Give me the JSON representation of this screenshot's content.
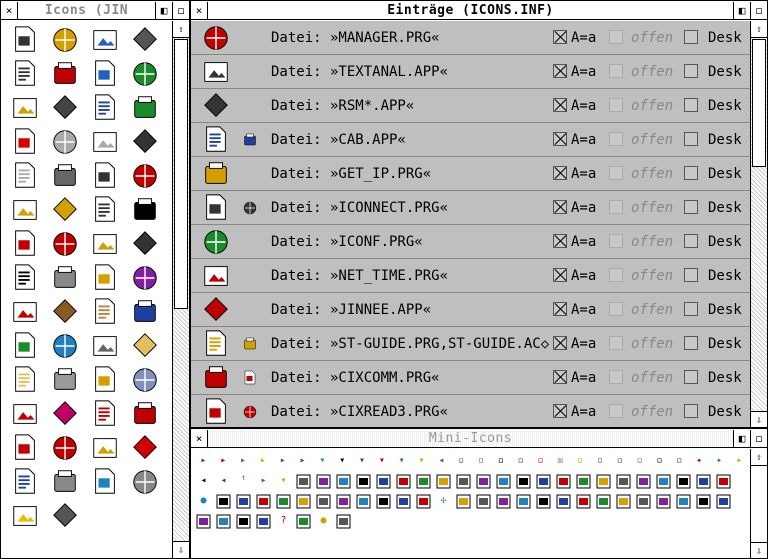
{
  "icons_window": {
    "title": "Icons (JIN",
    "close_glyph": "×",
    "icons": [
      {
        "name": "calculator-numbers-icon",
        "color": "#333"
      },
      {
        "name": "pencil-paper-icon",
        "color": "#d4a000"
      },
      {
        "name": "paint-document-icon",
        "color": "#2060c0"
      },
      {
        "name": "sound-device-icon",
        "color": "#555"
      },
      {
        "name": "grid-document-icon",
        "color": "#333"
      },
      {
        "name": "gif-document-icon",
        "color": "#c00000"
      },
      {
        "name": "jpeg-document-icon",
        "color": "#2060c0"
      },
      {
        "name": "globe-pencil-icon",
        "color": "#1a8a2a"
      },
      {
        "name": "tools-document-icon",
        "color": "#d4a000"
      },
      {
        "name": "text-pencil-icon",
        "color": "#444"
      },
      {
        "name": "painter-icon",
        "color": "#2040a0"
      },
      {
        "name": "tree-document-icon",
        "color": "#1a8a2a"
      },
      {
        "name": "german-flag-document-icon",
        "color": "#d40000"
      },
      {
        "name": "c-document-icon",
        "color": "#aaa"
      },
      {
        "name": "h-document-icon",
        "color": "#aaa"
      },
      {
        "name": "font-table-icon",
        "color": "#333"
      },
      {
        "name": "o-document-icon",
        "color": "#aaa"
      },
      {
        "name": "diamond-grid-icon",
        "color": "#666"
      },
      {
        "name": "help-k-document-icon",
        "color": "#333"
      },
      {
        "name": "abacus-icon",
        "color": "#c00000"
      },
      {
        "name": "zip-document-icon",
        "color": "#d4a000"
      },
      {
        "name": "hay-document-icon",
        "color": "#d4a000"
      },
      {
        "name": "question-document-icon",
        "color": "#333"
      },
      {
        "name": "question-dark-document-icon",
        "color": "#000"
      },
      {
        "name": "red-dragon-icon",
        "color": "#c00000"
      },
      {
        "name": "red-dragon-2-icon",
        "color": "#c00000"
      },
      {
        "name": "duck-icon",
        "color": "#d4a000"
      },
      {
        "name": "dog-icon",
        "color": "#333"
      },
      {
        "name": "panda-icon",
        "color": "#000"
      },
      {
        "name": "einstein-icon",
        "color": "#888"
      },
      {
        "name": "binders-icon",
        "color": "#d4a000"
      },
      {
        "name": "purple-book-icon",
        "color": "#8020a0"
      },
      {
        "name": "red-book-icon",
        "color": "#c00000"
      },
      {
        "name": "ruler-document-icon",
        "color": "#8a5a20"
      },
      {
        "name": "doctor-icon",
        "color": "#c08040"
      },
      {
        "name": "www-globe-icon",
        "color": "#2040a0"
      },
      {
        "name": "satellite-globe-icon",
        "color": "#1a8a2a"
      },
      {
        "name": "earth-globe-icon",
        "color": "#2080c0"
      },
      {
        "name": "satellite-dish-icon",
        "color": "#666"
      },
      {
        "name": "open-folder-icon",
        "color": "#e0c060"
      },
      {
        "name": "folder-icon",
        "color": "#e0c060"
      },
      {
        "name": "white-diamond-icon",
        "color": "#999"
      },
      {
        "name": "pencil-diamond-icon",
        "color": "#d4a000"
      },
      {
        "name": "blue-diamond-icon",
        "color": "#8090c0"
      },
      {
        "name": "color-cubes-icon",
        "color": "#c00000"
      },
      {
        "name": "red-cube-icon",
        "color": "#c00060"
      },
      {
        "name": "red-diamond-icon",
        "color": "#c00000"
      },
      {
        "name": "quill-diamond-icon",
        "color": "#c00000"
      },
      {
        "name": "crossed-cubes-icon",
        "color": "#c00000"
      },
      {
        "name": "crossed-diamond-icon",
        "color": "#c00000"
      },
      {
        "name": "pencil-pad-icon",
        "color": "#d4a000"
      },
      {
        "name": "exclamation-icon",
        "color": "#d40000"
      },
      {
        "name": "info-person-icon",
        "color": "#2040a0"
      },
      {
        "name": "printer-icon",
        "color": "#888"
      },
      {
        "name": "monitor-icon",
        "color": "#2080c0"
      },
      {
        "name": "computer-icon",
        "color": "#888"
      },
      {
        "name": "lightbulb-icon",
        "color": "#e0c000"
      },
      {
        "name": "trash-icon",
        "color": "#555"
      }
    ]
  },
  "entries_window": {
    "title": "Einträge (ICONS.INF)",
    "col_case": "A=a",
    "col_open": "offen",
    "col_desk": "Desk",
    "rows": [
      {
        "label": "Datei: »MANAGER.PRG«",
        "big": "phoenix-manager-icon",
        "small": "",
        "color": "#c00000"
      },
      {
        "label": "Datei: »TEXTANAL.APP«",
        "big": "magnifier-icon",
        "small": "",
        "color": "#333"
      },
      {
        "label": "Datei: »RSM*.APP«",
        "big": "swirl-icon",
        "small": "",
        "color": "#333"
      },
      {
        "label": "Datei: »CAB.APP«",
        "big": "cab-icon",
        "small": "cab-small-icon",
        "color": "#2040a0"
      },
      {
        "label": "Datei: »GET_IP.PRG«",
        "big": "question-ip-icon",
        "small": "",
        "color": "#d4a000"
      },
      {
        "label": "Datei: »ICONNECT.PRG«",
        "big": "modem-icon",
        "small": "antenna-small-icon",
        "color": "#333"
      },
      {
        "label": "Datei: »ICONF.PRG«",
        "big": "check-globe-icon",
        "small": "",
        "color": "#1a8a2a"
      },
      {
        "label": "Datei: »NET_TIME.PRG«",
        "big": "clock-globe-icon",
        "small": "",
        "color": "#c00000"
      },
      {
        "label": "Datei: »JINNEE.APP«",
        "big": "jinnee-icon",
        "small": "",
        "color": "#c00000"
      },
      {
        "label": "Datei: »ST-GUIDE.PRG,ST-GUIDE.AC◇",
        "big": "help-question-icon",
        "small": "question-small-icon",
        "color": "#d4a000"
      },
      {
        "label": "Datei: »CIXCOMM.PRG«",
        "big": "cix-icon",
        "small": "cix-small-icon",
        "color": "#c00000"
      },
      {
        "label": "Datei: »CIXREAD3.PRG«",
        "big": "cixread-icon",
        "small": "cix-small-icon",
        "color": "#c00000"
      }
    ]
  },
  "mini_window": {
    "title": "Mini-Icons",
    "rows": [
      [
        "▸",
        "▸",
        "▸",
        "▸",
        "▸",
        "▸",
        "▾",
        "▾",
        "▾",
        "▾",
        "▾",
        "▾",
        "◂",
        "▫",
        "▫",
        "▫",
        "▫",
        "▫",
        "☒",
        "▫",
        "▫",
        "▫",
        "▫",
        "▫",
        "▫",
        "✦",
        "✦",
        "✦"
      ],
      [
        "◂",
        "◂",
        "ᵗ",
        "▸",
        "▾",
        "▪",
        "▪",
        "▪",
        "▪",
        "▪",
        "▪",
        "▪",
        "▪",
        "▪",
        "▪",
        "▪",
        "▪",
        "▪",
        "▪",
        "▪",
        "▪",
        "▪",
        "▪",
        "▪",
        "▪",
        "▪",
        "▪"
      ],
      [
        "●",
        "▪",
        "▪",
        "▪",
        "▪",
        "▪",
        "▪",
        "▪",
        "▪",
        "▪",
        "▪",
        "▪",
        "✢",
        "▪",
        "▪",
        "▪",
        "▪",
        "▪",
        "▪",
        "▪",
        "▪",
        "▪",
        "▪",
        "▪",
        "▪",
        "▪",
        "▪"
      ],
      [
        "▪",
        "▪",
        "▪",
        "▪",
        "?",
        "▪",
        "●",
        "▪"
      ]
    ],
    "mini_colors": [
      "#2040a0",
      "#c00000",
      "#1a8a2a",
      "#d4a000",
      "#555",
      "#8020a0",
      "#2080c0",
      "#000"
    ]
  }
}
